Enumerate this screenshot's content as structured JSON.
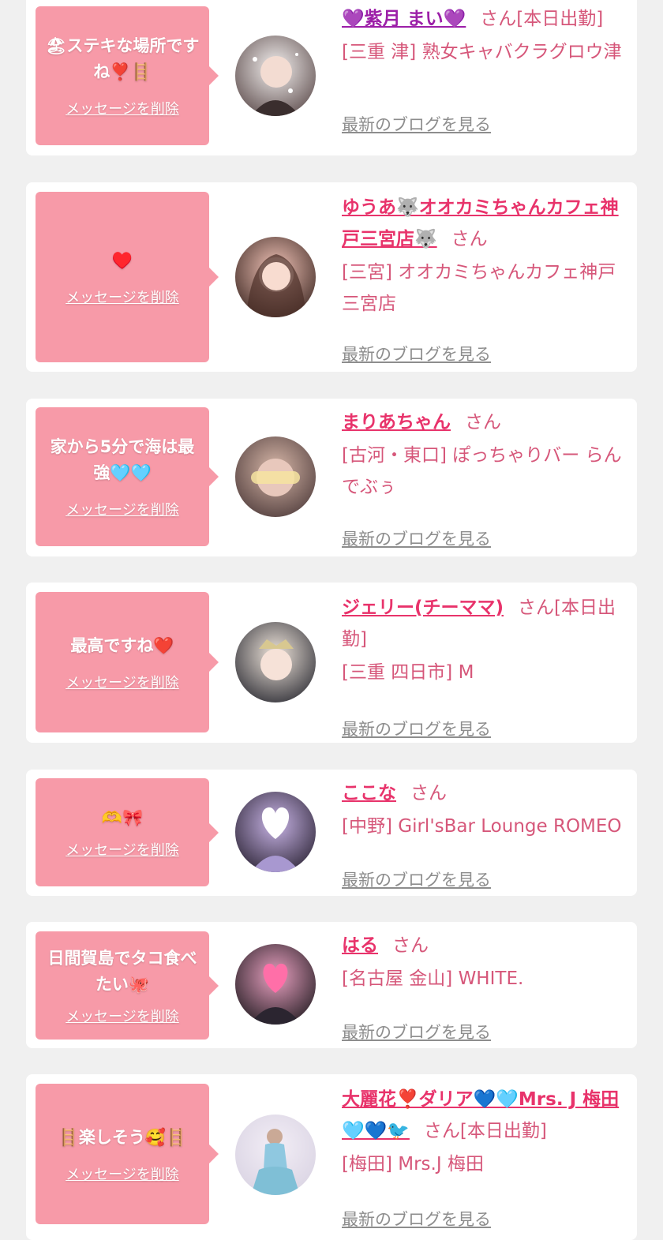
{
  "messages": [
    {
      "bubble_text": "🏖ステキな場所ですね❣️🪜",
      "delete_label": "メッセージを削除",
      "name": "💜紫月 まい💜",
      "suffix": "さん[本日出勤]",
      "store": "[三重 津] 熟女キャバクラグロウ津",
      "blog_label": "最新のブログを見る",
      "avatar_colors": [
        "#f4f1f0",
        "#5b4a4a"
      ]
    },
    {
      "bubble_text": "♥️",
      "delete_label": "メッセージを削除",
      "name": "ゆうあ🐺オオカミちゃんカフェ神戸三宮店🐺",
      "suffix": "さん",
      "store": "[三宮] オオカミちゃんカフェ神戸三宮店",
      "blog_label": "最新のブログを見る",
      "avatar_colors": [
        "#f2c4b8",
        "#3a2520"
      ]
    },
    {
      "bubble_text": "家から5分で海は最強🩵🩵",
      "delete_label": "メッセージを削除",
      "name": "まりあちゃん",
      "suffix": "さん",
      "store": "[古河・東口] ぽっちゃりバー らんでぶぅ",
      "blog_label": "最新のブログを見る",
      "avatar_colors": [
        "#d7b7a8",
        "#4d3a3a"
      ]
    },
    {
      "bubble_text": "最高ですね❤️",
      "delete_label": "メッセージを削除",
      "name": "ジェリー(チーママ)",
      "suffix": "さん[本日出勤]",
      "store": "[三重 四日市] M",
      "blog_label": "最新のブログを見る",
      "avatar_colors": [
        "#f0e6dc",
        "#2b2b33"
      ]
    },
    {
      "bubble_text": "🫶🎀",
      "delete_label": "メッセージを削除",
      "name": "ここな",
      "suffix": "さん",
      "store": "[中野] Girl'sBar Lounge ROMEO",
      "blog_label": "最新のブログを見る",
      "avatar_colors": [
        "#c8b4e6",
        "#2a2233"
      ]
    },
    {
      "bubble_text": "日間賀島でタコ食べたい🐙",
      "delete_label": "メッセージを削除",
      "name": "はる",
      "suffix": "さん",
      "store": "[名古屋 金山] WHITE.",
      "blog_label": "最新のブログを見る",
      "avatar_colors": [
        "#e8a0c0",
        "#1f1a1f"
      ]
    },
    {
      "bubble_text": "🪜楽しそう🥰🪜",
      "delete_label": "メッセージを削除",
      "name": "大麗花❣️ダリア💙🩵Mrs. J 梅田🩵💙🐦",
      "suffix": "さん[本日出勤]",
      "store": "[梅田] Mrs.J 梅田",
      "blog_label": "最新のブログを見る",
      "avatar_colors": [
        "#f3eef6",
        "#7fbfd6"
      ]
    }
  ]
}
